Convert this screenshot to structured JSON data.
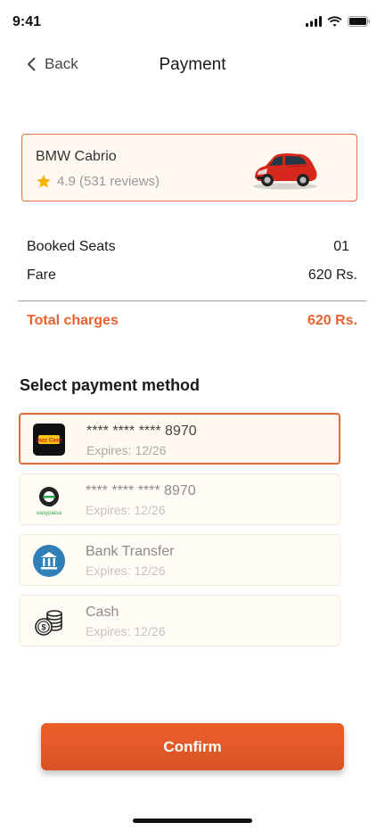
{
  "status_bar": {
    "time": "9:41"
  },
  "header": {
    "back_label": "Back",
    "title": "Payment"
  },
  "car": {
    "name": "BMW Cabrio",
    "rating": "4.9 (531 reviews)"
  },
  "fare": {
    "rows": [
      {
        "label": "Booked Seats",
        "value": "01"
      },
      {
        "label": "Fare",
        "value": "620 Rs."
      }
    ],
    "total_label": "Total charges",
    "total_value": "620 Rs."
  },
  "payment": {
    "section_title": "Select payment method",
    "options": [
      {
        "icon": "jazzcash-logo",
        "logo_text": "Jazz Cash",
        "title": "**** **** **** 8970",
        "subtitle": "Expires: 12/26",
        "selected": true
      },
      {
        "icon": "easypaisa-logo",
        "logo_text": "easypaisa",
        "title": "**** **** **** 8970",
        "subtitle": "Expires: 12/26",
        "selected": false
      },
      {
        "icon": "bank-icon",
        "title": "Bank Transfer",
        "subtitle": "Expires: 12/26",
        "selected": false
      },
      {
        "icon": "cash-coins-icon",
        "title": "Cash",
        "subtitle": "Expires: 12/26",
        "selected": false
      }
    ]
  },
  "confirm_label": "Confirm",
  "colors": {
    "accent": "#e9622f",
    "card_bg": "#fff8f1",
    "selected_border": "#e26a3a"
  }
}
